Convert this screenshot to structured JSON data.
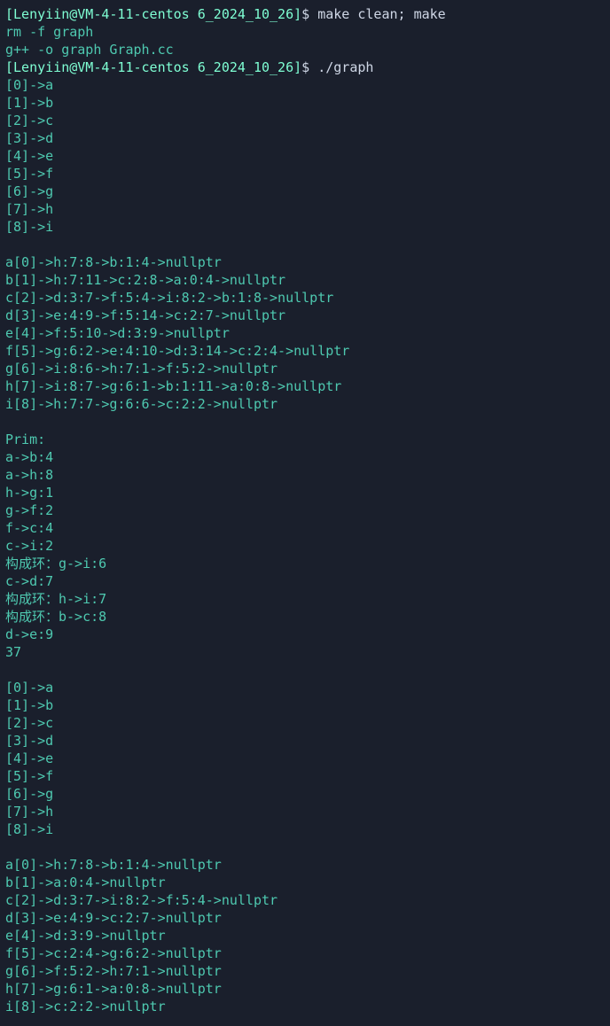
{
  "prompt1": {
    "userhost": "[Lenyiin@VM-4-11-centos",
    "path": "6_2024_10_26]",
    "dollar": "$",
    "cmd": "make clean; make"
  },
  "out1": "rm -f graph",
  "out2": "g++ -o graph Graph.cc",
  "prompt2": {
    "userhost": "[Lenyiin@VM-4-11-centos",
    "path": "6_2024_10_26]",
    "dollar": "$",
    "cmd": "./graph"
  },
  "o3": "[0]->a",
  "o4": "[1]->b",
  "o5": "[2]->c",
  "o6": "[3]->d",
  "o7": "[4]->e",
  "o8": "[5]->f",
  "o9": "[6]->g",
  "o10": "[7]->h",
  "o11": "[8]->i",
  "o12": "",
  "o13": "a[0]->h:7:8->b:1:4->nullptr",
  "o14": "b[1]->h:7:11->c:2:8->a:0:4->nullptr",
  "o15": "c[2]->d:3:7->f:5:4->i:8:2->b:1:8->nullptr",
  "o16": "d[3]->e:4:9->f:5:14->c:2:7->nullptr",
  "o17": "e[4]->f:5:10->d:3:9->nullptr",
  "o18": "f[5]->g:6:2->e:4:10->d:3:14->c:2:4->nullptr",
  "o19": "g[6]->i:8:6->h:7:1->f:5:2->nullptr",
  "o20": "h[7]->i:8:7->g:6:1->b:1:11->a:0:8->nullptr",
  "o21": "i[8]->h:7:7->g:6:6->c:2:2->nullptr",
  "o22": "",
  "o23": "Prim:",
  "o24": "a->b:4",
  "o25": "a->h:8",
  "o26": "h->g:1",
  "o27": "g->f:2",
  "o28": "f->c:4",
  "o29": "c->i:2",
  "o30": "构成环：g->i:6",
  "o31": "c->d:7",
  "o32": "构成环：h->i:7",
  "o33": "构成环：b->c:8",
  "o34": "d->e:9",
  "o35": "37",
  "o36": "",
  "o37": "[0]->a",
  "o38": "[1]->b",
  "o39": "[2]->c",
  "o40": "[3]->d",
  "o41": "[4]->e",
  "o42": "[5]->f",
  "o43": "[6]->g",
  "o44": "[7]->h",
  "o45": "[8]->i",
  "o46": "",
  "o47": "a[0]->h:7:8->b:1:4->nullptr",
  "o48": "b[1]->a:0:4->nullptr",
  "o49": "c[2]->d:3:7->i:8:2->f:5:4->nullptr",
  "o50": "d[3]->e:4:9->c:2:7->nullptr",
  "o51": "e[4]->d:3:9->nullptr",
  "o52": "f[5]->c:2:4->g:6:2->nullptr",
  "o53": "g[6]->f:5:2->h:7:1->nullptr",
  "o54": "h[7]->g:6:1->a:0:8->nullptr",
  "o55": "i[8]->c:2:2->nullptr"
}
